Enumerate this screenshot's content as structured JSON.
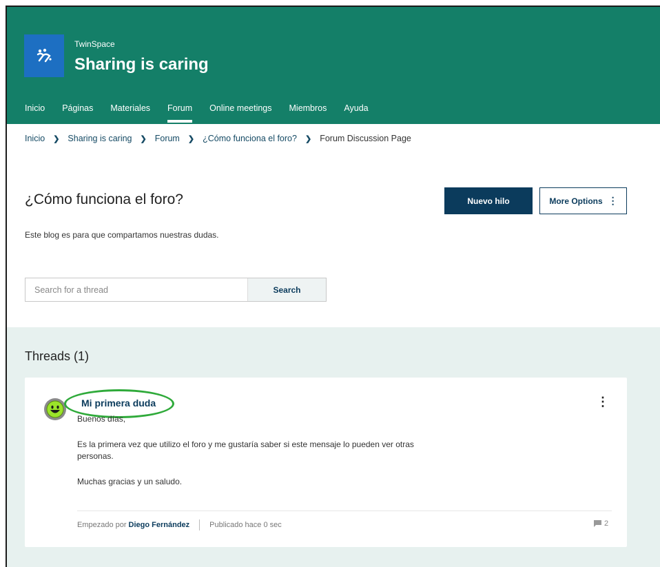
{
  "header": {
    "site_subtitle": "TwinSpace",
    "site_title": "Sharing is caring",
    "logo_icon": "twinspace-logo-icon",
    "nav": [
      {
        "label": "Inicio"
      },
      {
        "label": "Páginas"
      },
      {
        "label": "Materiales"
      },
      {
        "label": "Forum",
        "active": true
      },
      {
        "label": "Online meetings"
      },
      {
        "label": "Miembros"
      },
      {
        "label": "Ayuda"
      }
    ]
  },
  "breadcrumb": [
    "Inicio",
    "Sharing is caring",
    "Forum",
    "¿Cómo funciona el foro?",
    "Forum Discussion Page"
  ],
  "page": {
    "title": "¿Cómo funciona el foro?",
    "description": "Este blog es para que compartamos nuestras dudas.",
    "new_thread_label": "Nuevo hilo",
    "more_options_label": "More Options",
    "more_options_icon": "⋮"
  },
  "search": {
    "placeholder": "Search for a thread",
    "value": "",
    "button_label": "Search"
  },
  "threads": {
    "heading": "Threads (1)",
    "items": [
      {
        "title": "Mi primera duda",
        "body": [
          "Buenos días,",
          "Es la primera vez que utilizo el foro y me gustaría saber si este mensaje lo pueden ver otras",
          "personas.",
          "Muchas gracias y un saludo."
        ],
        "started_by_label": "Empezado por",
        "author": "Diego Fernández",
        "published": "Publicado hace 0 sec",
        "reply_count": "2",
        "menu_icon": "⋮"
      }
    ]
  },
  "colors": {
    "header_bg": "#147f68",
    "logo_bg": "#1d6fc2",
    "primary": "#0b3b5c",
    "threads_bg": "#e7f1ef",
    "highlight_circle": "#2faa3a"
  }
}
